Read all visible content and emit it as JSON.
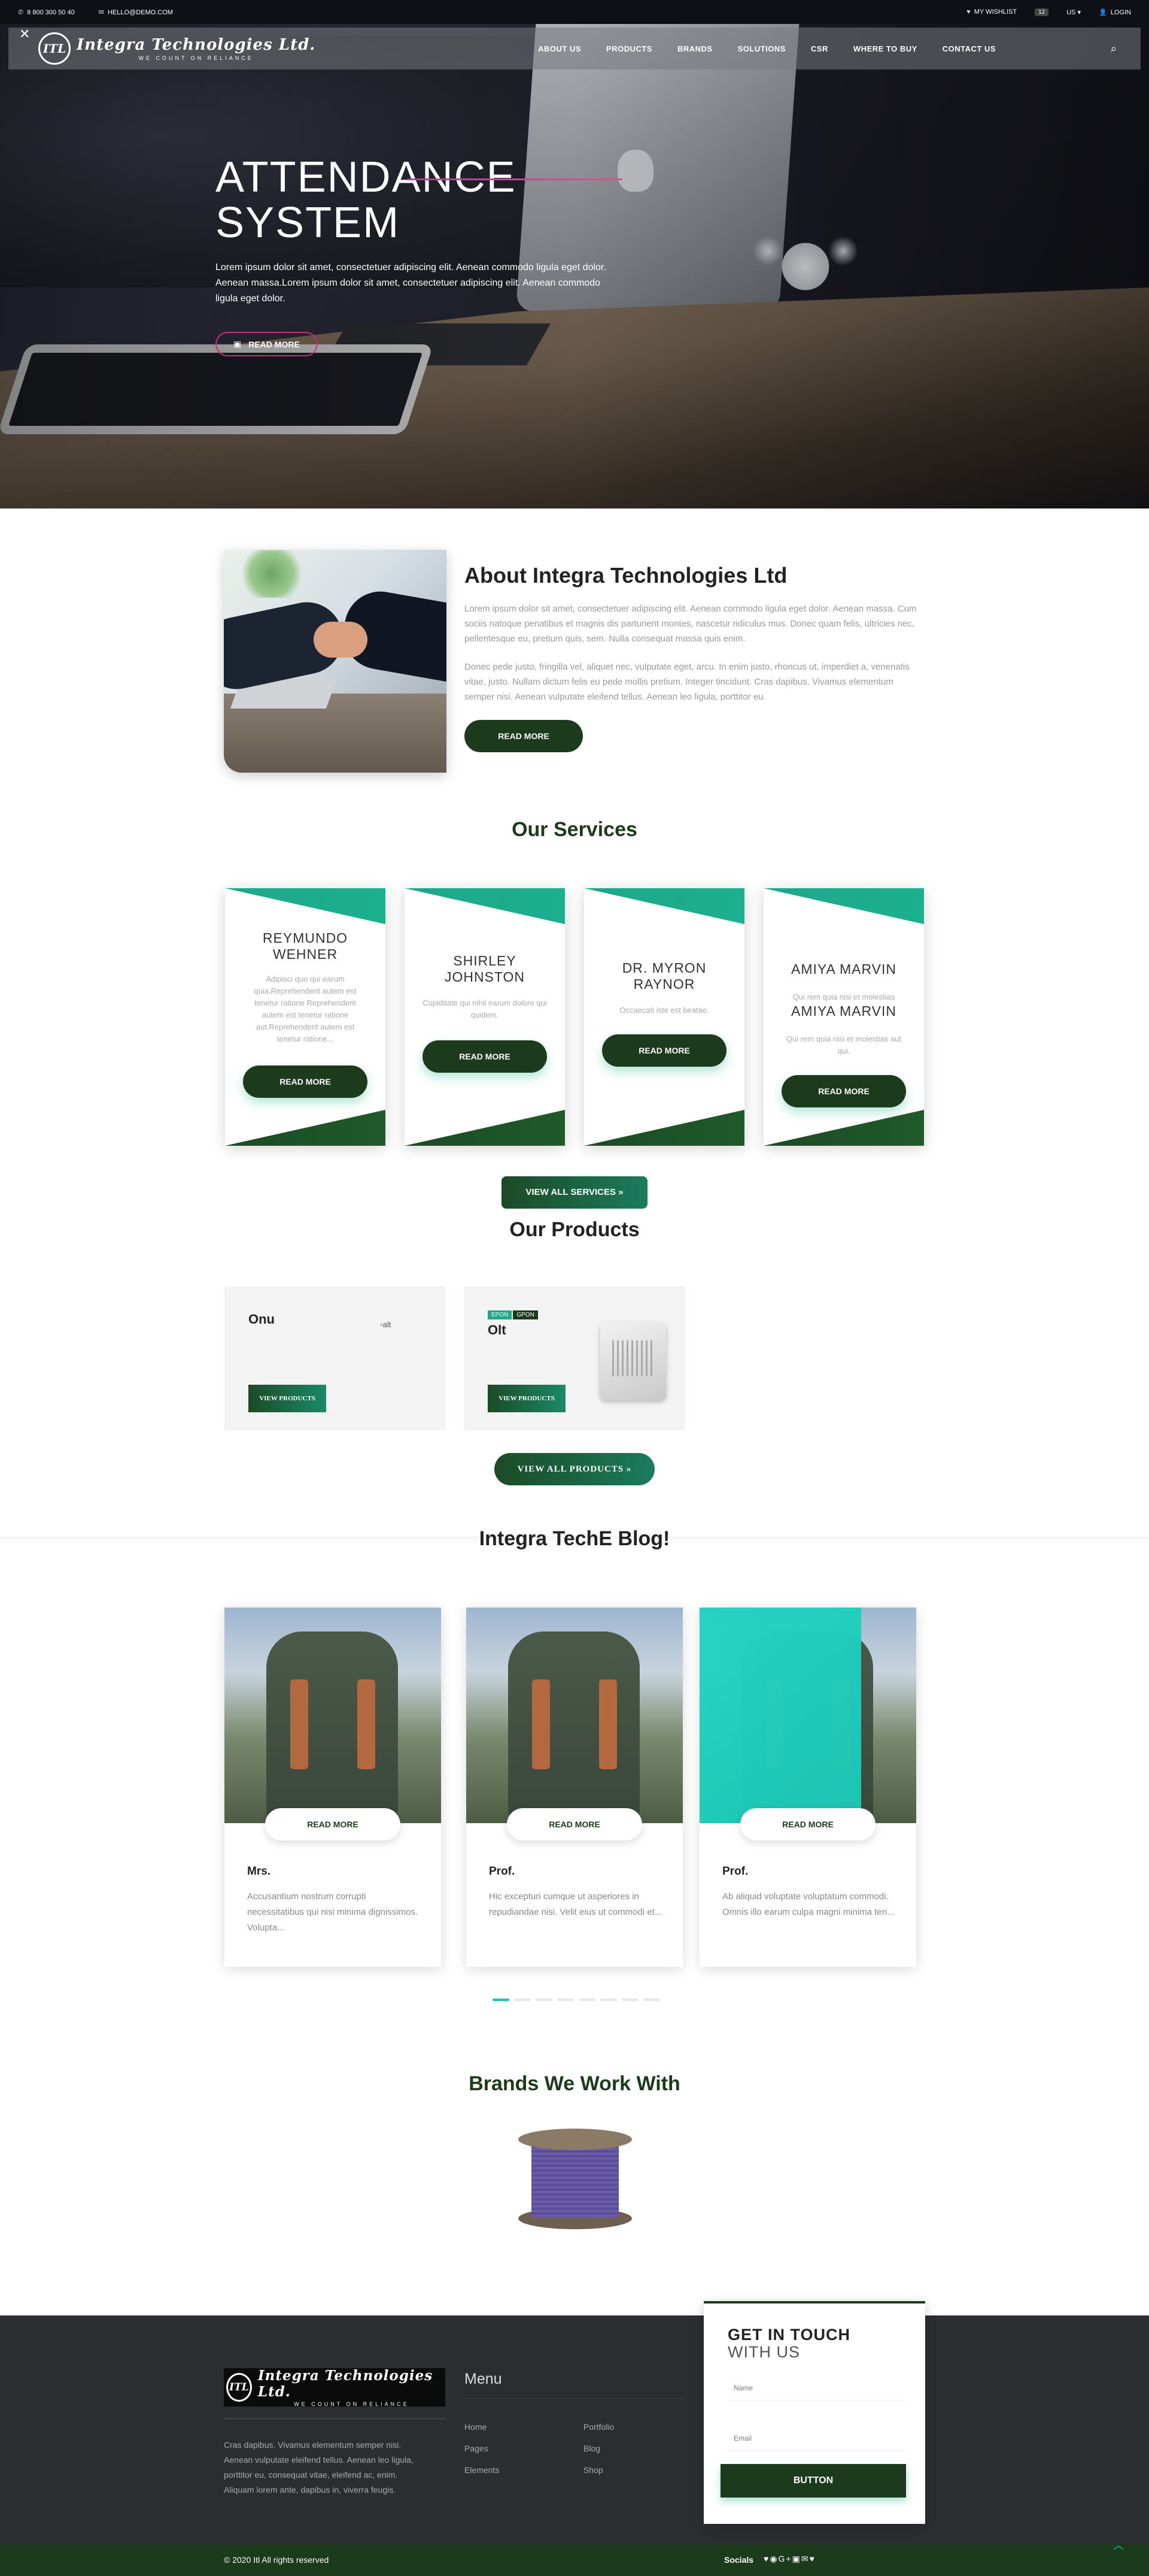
{
  "topbar": {
    "phone": "8 800 300 50 40",
    "email": "HELLO@DEMO.COM",
    "wishlist": "MY WISHLIST",
    "wishlist_count": "12",
    "currency": "US",
    "login": "LOGIN"
  },
  "header": {
    "logo_mark": "ITL",
    "logo_name": "Integra Technologies Ltd.",
    "logo_tagline": "WE COUNT ON RELIANCE",
    "nav": [
      "ABOUT US",
      "PRODUCTS",
      "BRANDS",
      "SOLUTIONS",
      "CSR",
      "WHERE TO BUY",
      "CONTACT US"
    ]
  },
  "hero": {
    "title_line1": "ATTENDANCE",
    "title_line2": "SYSTEM",
    "text": "Lorem ipsum dolor sit amet, consectetuer adipiscing elit. Aenean commodo ligula eget dolor. Aenean massa.Lorem ipsum dolor sit amet, consectetuer adipiscing elit. Aenean commodo ligula eget dolor.",
    "button": "READ MORE"
  },
  "about": {
    "title": "About Integra Technologies Ltd",
    "p1": "Lorem ipsum dolor sit amet, consectetuer adipiscing elit. Aenean commodo ligula eget dolor. Aenean massa. Cum sociis natoque penatibus et magnis dis parturient montes, nascetur ridiculus mus. Donec quam felis, ultricies nec, pellentesque eu, pretium quis, sem. Nulla consequat massa quis enim.",
    "p2": "Donec pede justo, fringilla vel, aliquet nec, vulputate eget, arcu. In enim justo, rhoncus ut, imperdiet a, venenatis vitae, justo. Nullam dictum felis eu pede mollis pretium. Integer tincidunt. Cras dapibus. Vivamus elementum semper nisi. Aenean vulputate eleifend tellus. Aenean leo ligula, porttitor eu.",
    "button": "READ MORE"
  },
  "services": {
    "title": "Our Services",
    "items": [
      {
        "name": "REYMUNDO WEHNER",
        "desc": "Adipisci quo qui earum quia.Reprehenderit autem est tenetur ratione Reprehenderit autem est tenetur ratione aut.Reprehenderit autem est tenetur ratione...",
        "button": "READ MORE"
      },
      {
        "name": "SHIRLEY JOHNSTON",
        "desc": "Cupiditate qui nihil earum dolore qui quidem.",
        "button": "READ MORE"
      },
      {
        "name": "DR. MYRON RAYNOR",
        "desc": "Occaecati iste est beatae.",
        "button": "READ MORE"
      },
      {
        "name": "AMIYA MARVIN",
        "desc": "Qui rem quia nisi et molestias",
        "name2": "AMIYA MARVIN",
        "desc2": "Qui rem quia nisi et molestias aut qui.",
        "button": "READ MORE"
      }
    ],
    "view_all": "VIEW ALL SERVICES »"
  },
  "products": {
    "title": "Our Products",
    "items": [
      {
        "name": "Onu",
        "img_alt": "alt",
        "button": "VIEW PRODUCTS"
      },
      {
        "name": "Olt",
        "tags": [
          "EPON",
          "GPON"
        ],
        "button": "VIEW PRODUCTS"
      }
    ],
    "view_all": "VIEW ALL PRODUCTS »"
  },
  "blog": {
    "title": "Integra TechE Blog!",
    "posts": [
      {
        "author": "Mrs.",
        "text": "Accusantium nostrum corrupti necessitatibus qui nisi minima dignissimos. Volupta...",
        "button": "READ MORE"
      },
      {
        "author": "Prof.",
        "text": "Hic excepturi cumque ut asperiores in repudiandae nisi. Velit eius ut commodi et...",
        "button": "READ MORE"
      },
      {
        "author": "Prof.",
        "text": "Ab aliquid voluptate voluptatum commodi. Omnis illo earum culpa magni minima ten...",
        "button": "READ MORE"
      }
    ],
    "pager_count": 8,
    "pager_active": 1
  },
  "brands": {
    "title": "Brands We Work With"
  },
  "footer": {
    "logo_mark": "ITL",
    "logo_name": "Integra Technologies Ltd.",
    "logo_tagline": "WE COUNT ON RELIANCE",
    "desc": "Cras dapibus. Vivamus elementum semper nisi. Aenean vulputate eleifend tellus. Aenean leo ligula, porttitor eu, consequat vitae, eleifend ac, enim. Aliquam lorem ante, dapibus in, viverra feugis.",
    "menu_title": "Menu",
    "menu_col1": [
      "Home",
      "Pages",
      "Elements"
    ],
    "menu_col2": [
      "Portfolio",
      "Blog",
      "Shop"
    ],
    "copyright": "© 2020 Itl All rights reserved",
    "socials_label": "Socials",
    "socials_icons": "♥◉G+▣✉♥"
  },
  "contact": {
    "title1": "GET IN TOUCH",
    "title2": "WITH US",
    "name_placeholder": "Name",
    "email_placeholder": "Email",
    "button": "BUTTON"
  },
  "colors": {
    "brand_dark_green": "#1c3a1c",
    "teal": "#1fa78a",
    "hero_accent": "#c0317f",
    "footer_bg": "#2b2d31"
  }
}
